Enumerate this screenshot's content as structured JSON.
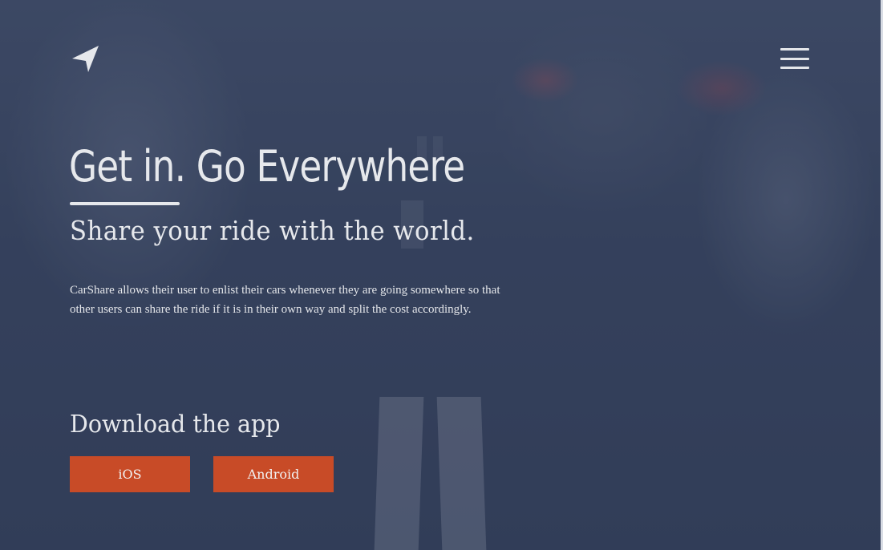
{
  "header": {
    "logo_icon": "navigation-arrow-icon",
    "menu_icon": "hamburger-menu-icon"
  },
  "hero": {
    "headline": "Get in. Go Everywhere",
    "subheadline": "Share your ride with the world.",
    "description": "CarShare allows their user to enlist their cars whenever they are going somewhere so that other users can share the ride if it is in their own way and split the cost accordingly."
  },
  "download": {
    "title": "Download the app",
    "ios_label": "iOS",
    "android_label": "Android"
  },
  "colors": {
    "accent": "#c84b27",
    "text": "#e6e8ec",
    "overlay": "#3d4a63"
  }
}
